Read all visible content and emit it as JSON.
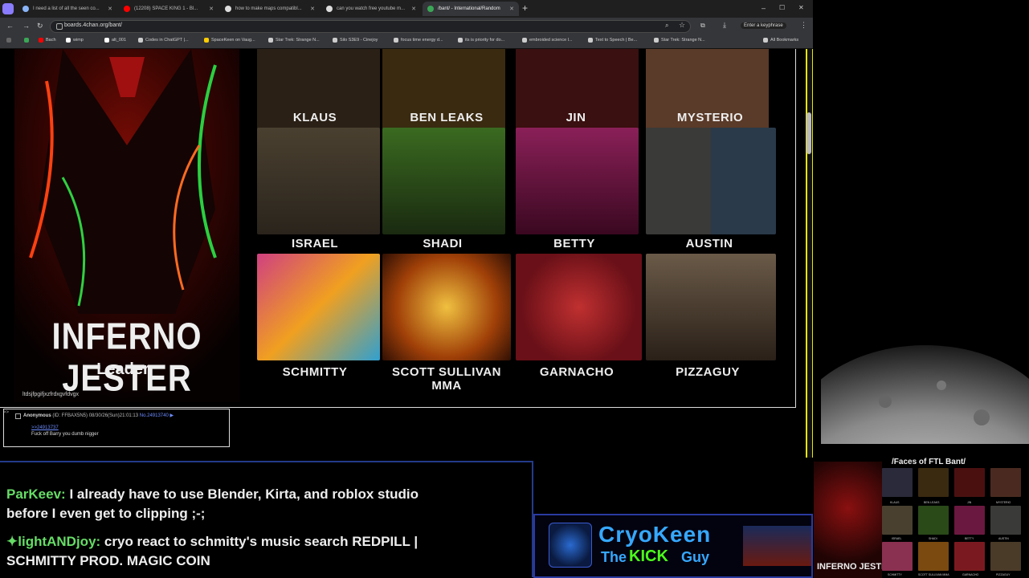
{
  "browser": {
    "tabs": [
      {
        "title": "I need a list of all the seen co...",
        "active": false,
        "color": "#8ab4f8"
      },
      {
        "title": "(12208) SPACE KING 1 - Bl...",
        "active": false,
        "color": "#ff0000"
      },
      {
        "title": "how to make maps compatibl...",
        "active": false,
        "color": "#dddddd"
      },
      {
        "title": "can you watch free youtube m...",
        "active": false,
        "color": "#dddddd"
      },
      {
        "title": "/bant/ - International/Random",
        "active": true,
        "color": "#3aa757"
      }
    ],
    "new_tab": "+",
    "window_controls": {
      "minimize": "–",
      "maximize": "☐",
      "close": "✕"
    },
    "url": "boards.4chan.org/bant/",
    "extension_label": "Enter a keyphrase",
    "bookmarks": [
      {
        "label": "",
        "color": "#3aa757"
      },
      {
        "label": "Bach",
        "color": "#ff0000"
      },
      {
        "label": "wimp",
        "color": "#ffffff"
      },
      {
        "label": "alt_001",
        "color": "#ffffff"
      },
      {
        "label": "Codes in ChatGPT |...",
        "color": "#cccccc"
      },
      {
        "label": "SpaceKeen on Vaug...",
        "color": "#ffcc00"
      },
      {
        "label": "Star Trek: Strange N...",
        "color": "#cccccc"
      },
      {
        "label": "Silo S3E9 - Cinejoy",
        "color": "#cccccc"
      },
      {
        "label": "focus time energy d...",
        "color": "#cccccc"
      },
      {
        "label": "its is priority for do...",
        "color": "#cccccc"
      },
      {
        "label": "embroided science l...",
        "color": "#cccccc"
      },
      {
        "label": "Text to Speech | Be...",
        "color": "#cccccc"
      },
      {
        "label": "Star Trek: Strange N...",
        "color": "#cccccc"
      }
    ],
    "all_bookmarks": "All Bookmarks"
  },
  "post": {
    "leader_name": "INFERNO JESTER",
    "leader_role": "Leader",
    "filename_text": "ltdsjfpgifjxzfrdxgvfdvgx",
    "tiles": [
      {
        "name": "KLAUS",
        "bg": "#2a2015"
      },
      {
        "name": "BEN LEAKS",
        "bg": "#3a2a10"
      },
      {
        "name": "JIN",
        "bg": "#3a1010"
      },
      {
        "name": "MYSTERIO",
        "bg": "#3a2a20"
      },
      {
        "name": "ISRAEL",
        "bg": "#4a4030"
      },
      {
        "name": "SHADI",
        "bg": "#2a4a18"
      },
      {
        "name": "BETTY",
        "bg": "#5a1838"
      },
      {
        "name": "AUSTIN",
        "bg": "#3a3a38"
      },
      {
        "name": "SCHMITTY",
        "bg": "#6a2848"
      },
      {
        "name": "SCOTT SULLIVAN MMA",
        "bg": "#6a4010"
      },
      {
        "name": "GARNACHO",
        "bg": "#6a1a20"
      },
      {
        "name": "PIZZAGUY",
        "bg": "#3a2a20"
      }
    ]
  },
  "reply": {
    "author": "Anonymous",
    "id": "(ID: FFBAX5N5)",
    "date": "08/30/26(Sun)21:01:13",
    "number": "No.24913740",
    "quote": ">>24913737",
    "text": "Fuck off Barry you dumb nigger"
  },
  "chat": [
    {
      "user": "ParKeev:",
      "message": "I already have to use Blender, Kirta, and roblox studio before I even get to clipping ;-;"
    },
    {
      "user": "lightANDjoy:",
      "message": "cryo react to schmitty's music search REDPILL | SCHMITTY PROD. MAGIC COIN"
    }
  ],
  "logo": {
    "title": "CryoKeen",
    "sub1": "The",
    "sub2": "KICK",
    "sub3": "Guy"
  },
  "faces": {
    "title": "/Faces of FTL Bant/",
    "leader": "INFERNO JESTER",
    "names": [
      "KLAUS",
      "BEN LEAKS",
      "JIN",
      "MYSTERIO",
      "ISRAEL",
      "SHADI",
      "BETTY",
      "AUSTIN",
      "SCHMITTY",
      "SCOTT SULLIVAN MMA",
      "GARNACHO",
      "PIZZAGUY"
    ]
  },
  "colors": {
    "accent_blue": "#243a8a",
    "scrollbar_yellow": "#e8e800",
    "chat_name_green": "#66dd66"
  }
}
